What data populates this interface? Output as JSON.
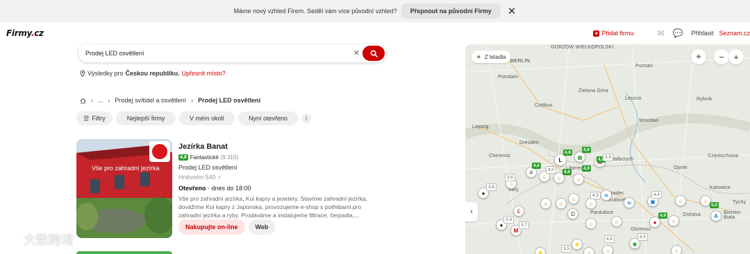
{
  "banner": {
    "text": "Máme nový vzhled Firem. Seděl vám více původní vzhled?",
    "button": "Přepnout na původní Firmy",
    "close_icon": "close-icon"
  },
  "header": {
    "logo": "Firmy",
    "logo_suffix": "cz",
    "add_firm": "Přidat firmu",
    "login": "Přihlásit",
    "seznam": "Seznam.cz"
  },
  "search": {
    "value": "Prodej LED osvětlení",
    "results_prefix": "Výsledky pro",
    "results_region": "Českou republiku.",
    "refine": "Upřesnit místo?"
  },
  "breadcrumb": {
    "ellipsis": "...",
    "parent": "Prodej svítidel a osvětlení",
    "current": "Prodej LED osvětlení"
  },
  "filters": {
    "filter": "Filtry",
    "best": "Nejlepší firmy",
    "nearby": "V mém okolí",
    "open_now": "Nyní otevřeno",
    "info": "i"
  },
  "result": {
    "title": "Jezírka Banat",
    "score": "4,8",
    "rating_label": "Fantastické",
    "rating_count": "(9 310)",
    "category": "Prodej LED osvětlení",
    "address": "Hněvotín 540",
    "open_status": "Otevřeno",
    "open_hours": "· dnes do 18:00",
    "description": "Vše pro zahradní jezírka, Koi kapry a jesetery. Stavíme zahradní jezírka, dovážíme Koi kapry z Japonska, provozujeme e-shop s potřebami pro zahradní jezírka a ryby. Prodáváme a instalujeme filtrace, čerpadla,...",
    "shop_button": "Nakupujte on-line",
    "web_button": "Web",
    "image_text": "Vše pro zahradní jezírka"
  },
  "map": {
    "airport": "Z letadla",
    "labels": {
      "gorzow": "GORZÓW WIELKOPOLSKI",
      "berlin": "BERLIN",
      "poznan": "Poznań",
      "potsdam": "Potsdam",
      "zielona": "Zielona Góra",
      "cottbus": "Cottbus",
      "leszno": "Leszno",
      "rybnik": "Rybnik",
      "leipzig": "Leipzig",
      "wroclaw": "Wrocław",
      "dresden": "Dresden",
      "chemnitz": "Chemnitz",
      "walbrzych": "Wałbrzych",
      "opole": "Opole",
      "czestochowa": "Częstochowa",
      "katowice": "Katowice",
      "hradec": "Hradec",
      "kralove": "Králové",
      "pardubice": "Pardubice",
      "olomouc": "Olomouc",
      "ostrava": "Ostrava",
      "bielsko": "Bielsko-Biała",
      "tychy": "Tychy",
      "vary": "Vary",
      "liberec": "Liberec"
    },
    "ratings": [
      "4,8",
      "4,9",
      "4,6",
      "4,9",
      "4,6",
      "4,9",
      "3,9",
      "3,6",
      "4,0",
      "3,8",
      "3,9",
      "3,7",
      "4,5",
      "4,4",
      "4,9",
      "5,0",
      "3,5",
      "4,6",
      "4,5"
    ]
  },
  "watermark": "大数跨境"
}
